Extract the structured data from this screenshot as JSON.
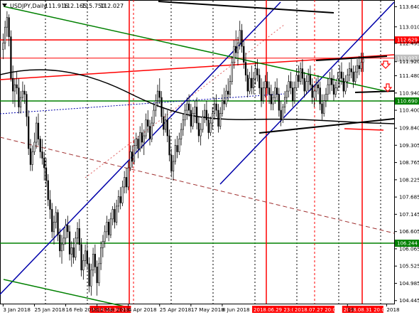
{
  "chart_data": {
    "type": "candlestick",
    "title": "USDJPY,Daily",
    "ohlc": {
      "open": "111.916",
      "high": "112.165",
      "low": "115.750",
      "close": "112.027"
    },
    "ylim": [
      104.35,
      113.85
    ],
    "y_ticks": [
      113.64,
      113.01,
      112.495,
      111.92,
      111.48,
      110.94,
      110.4,
      109.84,
      109.305,
      108.765,
      108.225,
      107.685,
      107.145,
      106.605,
      106.065,
      105.525,
      104.985,
      104.445
    ],
    "y_tick_labels": [
      "113.640",
      "113.010",
      "112.495",
      "111.920",
      "111.480",
      "110.940",
      "110.400",
      "109.840",
      "109.305",
      "108.765",
      "108.225",
      "107.685",
      "107.145",
      "106.605",
      "106.065",
      "105.525",
      "104.985",
      "104.445"
    ],
    "x_tick_labels": [
      "3 Jan 2018",
      "25 Jan 2018",
      "16 Feb 2018",
      "12 Mar 2018",
      "4 Apr 2018",
      "25 Apr 2018",
      "17 May 2018",
      "8 Jun 2018",
      "19",
      "2018"
    ],
    "x_tick_index": [
      0,
      16,
      32,
      48,
      64,
      80,
      96,
      112,
      176,
      196
    ],
    "n_bars": 200,
    "price_tags": [
      {
        "value": 112.6,
        "text": "112.629",
        "color": "#ff0000"
      },
      {
        "value": 112.03,
        "text": "112.027",
        "color": "#c0c0c0"
      },
      {
        "value": 110.69,
        "text": "110.690",
        "color": "#008000"
      },
      {
        "value": 106.24,
        "text": "106.244",
        "color": "#008000"
      }
    ],
    "date_tags": [
      {
        "index": 53,
        "text": "2018.03.30 23:00"
      },
      {
        "index": 136,
        "text": "2018.06.29 23:00"
      },
      {
        "index": 157,
        "text": "2018.07.27 20:00"
      },
      {
        "index": 182,
        "text": "2018.08.31 20:00"
      }
    ],
    "candles": [
      [
        112.3,
        112.8,
        112.0,
        112.5
      ],
      [
        112.5,
        113.2,
        112.3,
        113.0
      ],
      [
        113.0,
        113.5,
        112.7,
        113.3
      ],
      [
        113.3,
        113.4,
        112.4,
        112.7
      ],
      [
        112.7,
        112.9,
        111.3,
        111.4
      ],
      [
        111.4,
        111.8,
        110.6,
        111.0
      ],
      [
        111.0,
        111.4,
        110.5,
        111.2
      ],
      [
        111.2,
        111.6,
        110.9,
        111.1
      ],
      [
        111.1,
        111.4,
        110.3,
        110.5
      ],
      [
        110.5,
        111.0,
        110.3,
        110.8
      ],
      [
        110.8,
        111.3,
        110.7,
        111.0
      ],
      [
        111.0,
        111.2,
        110.6,
        110.9
      ],
      [
        110.9,
        111.0,
        109.9,
        110.2
      ],
      [
        110.2,
        110.4,
        109.0,
        109.2
      ],
      [
        109.2,
        109.5,
        108.5,
        108.7
      ],
      [
        108.7,
        109.3,
        108.5,
        109.1
      ],
      [
        109.1,
        109.7,
        109.0,
        109.4
      ],
      [
        109.4,
        110.2,
        109.2,
        110.0
      ],
      [
        110.0,
        110.3,
        109.3,
        109.5
      ],
      [
        109.5,
        109.6,
        108.9,
        109.1
      ],
      [
        109.1,
        109.5,
        108.7,
        108.9
      ],
      [
        108.9,
        109.1,
        108.2,
        108.6
      ],
      [
        108.6,
        108.9,
        108.0,
        108.2
      ],
      [
        108.2,
        108.4,
        107.4,
        107.6
      ],
      [
        107.6,
        107.9,
        107.0,
        107.3
      ],
      [
        107.3,
        107.5,
        106.4,
        106.6
      ],
      [
        106.6,
        107.1,
        106.2,
        106.9
      ],
      [
        106.9,
        107.4,
        106.7,
        107.2
      ],
      [
        107.2,
        107.3,
        106.3,
        106.5
      ],
      [
        106.5,
        106.7,
        105.8,
        106.0
      ],
      [
        106.0,
        106.5,
        105.6,
        106.2
      ],
      [
        106.2,
        106.7,
        106.0,
        106.4
      ],
      [
        106.4,
        107.0,
        106.2,
        106.8
      ],
      [
        106.8,
        107.1,
        106.4,
        106.6
      ],
      [
        106.6,
        106.8,
        105.7,
        105.9
      ],
      [
        105.9,
        106.3,
        105.5,
        106.1
      ],
      [
        106.1,
        106.4,
        105.6,
        105.8
      ],
      [
        105.8,
        106.6,
        105.7,
        106.4
      ],
      [
        106.4,
        106.9,
        106.2,
        106.7
      ],
      [
        106.7,
        107.0,
        106.0,
        106.2
      ],
      [
        106.2,
        106.4,
        105.2,
        105.4
      ],
      [
        105.4,
        105.9,
        105.1,
        105.7
      ],
      [
        105.7,
        106.2,
        105.5,
        106.0
      ],
      [
        106.0,
        106.3,
        105.4,
        105.6
      ],
      [
        105.6,
        105.8,
        104.7,
        104.9
      ],
      [
        104.9,
        105.6,
        104.6,
        105.4
      ],
      [
        105.4,
        106.1,
        105.2,
        105.9
      ],
      [
        105.9,
        106.2,
        105.3,
        105.5
      ],
      [
        105.5,
        105.7,
        104.6,
        105.0
      ],
      [
        105.0,
        105.8,
        104.9,
        105.6
      ],
      [
        105.6,
        106.3,
        105.4,
        106.1
      ],
      [
        106.1,
        106.5,
        105.8,
        106.3
      ],
      [
        106.3,
        106.8,
        106.1,
        106.6
      ],
      [
        106.6,
        107.1,
        106.4,
        106.9
      ],
      [
        106.9,
        107.0,
        106.3,
        106.5
      ],
      [
        106.5,
        107.2,
        106.4,
        107.0
      ],
      [
        107.0,
        107.4,
        106.8,
        107.3
      ],
      [
        107.3,
        107.5,
        106.7,
        106.9
      ],
      [
        106.9,
        107.6,
        106.8,
        107.4
      ],
      [
        107.4,
        107.9,
        107.2,
        107.7
      ],
      [
        107.7,
        108.0,
        107.3,
        107.5
      ],
      [
        107.5,
        108.2,
        107.4,
        108.0
      ],
      [
        108.0,
        108.5,
        107.8,
        108.3
      ],
      [
        108.3,
        108.6,
        107.8,
        108.0
      ],
      [
        108.0,
        108.8,
        107.9,
        108.6
      ],
      [
        108.6,
        109.3,
        108.5,
        109.1
      ],
      [
        109.1,
        109.3,
        108.6,
        108.8
      ],
      [
        108.8,
        109.5,
        108.7,
        109.3
      ],
      [
        109.3,
        109.7,
        109.1,
        109.5
      ],
      [
        109.5,
        109.6,
        108.9,
        109.2
      ],
      [
        109.2,
        109.9,
        109.1,
        109.7
      ],
      [
        109.7,
        110.0,
        109.2,
        109.4
      ],
      [
        109.4,
        109.8,
        109.0,
        109.6
      ],
      [
        109.6,
        110.3,
        109.5,
        110.1
      ],
      [
        110.1,
        110.4,
        109.7,
        109.9
      ],
      [
        109.9,
        110.1,
        109.3,
        109.5
      ],
      [
        109.5,
        110.2,
        109.4,
        110.0
      ],
      [
        110.0,
        110.6,
        109.9,
        110.4
      ],
      [
        110.4,
        110.9,
        110.2,
        110.7
      ],
      [
        110.7,
        111.2,
        110.5,
        111.0
      ],
      [
        111.0,
        111.4,
        110.6,
        110.8
      ],
      [
        110.8,
        111.0,
        110.0,
        110.2
      ],
      [
        110.2,
        110.5,
        109.6,
        109.8
      ],
      [
        109.8,
        110.3,
        109.7,
        110.1
      ],
      [
        110.1,
        110.4,
        109.4,
        109.6
      ],
      [
        109.6,
        109.8,
        108.8,
        109.0
      ],
      [
        109.0,
        109.2,
        108.3,
        108.5
      ],
      [
        108.5,
        109.0,
        108.2,
        108.8
      ],
      [
        108.8,
        109.5,
        108.7,
        109.3
      ],
      [
        109.3,
        109.6,
        108.9,
        109.1
      ],
      [
        109.1,
        109.7,
        109.0,
        109.5
      ],
      [
        109.5,
        110.0,
        109.3,
        109.8
      ],
      [
        109.8,
        110.3,
        109.6,
        110.1
      ],
      [
        110.1,
        110.6,
        109.9,
        110.4
      ],
      [
        110.4,
        110.8,
        110.1,
        110.6
      ],
      [
        110.6,
        110.9,
        110.2,
        110.4
      ],
      [
        110.4,
        110.6,
        109.7,
        109.9
      ],
      [
        109.9,
        110.5,
        109.8,
        110.3
      ],
      [
        110.3,
        110.7,
        110.0,
        110.5
      ],
      [
        110.5,
        110.8,
        109.8,
        110.0
      ],
      [
        110.0,
        110.2,
        109.4,
        109.6
      ],
      [
        109.6,
        110.0,
        109.3,
        109.8
      ],
      [
        109.8,
        110.4,
        109.7,
        110.2
      ],
      [
        110.2,
        110.6,
        110.0,
        110.4
      ],
      [
        110.4,
        110.7,
        109.9,
        110.1
      ],
      [
        110.1,
        110.3,
        109.5,
        109.7
      ],
      [
        109.7,
        110.2,
        109.6,
        110.0
      ],
      [
        110.0,
        110.5,
        109.8,
        110.3
      ],
      [
        110.3,
        110.8,
        110.1,
        110.6
      ],
      [
        110.6,
        110.9,
        110.2,
        110.4
      ],
      [
        110.4,
        110.6,
        109.7,
        109.9
      ],
      [
        109.9,
        110.5,
        109.8,
        110.3
      ],
      [
        110.3,
        110.9,
        110.2,
        110.7
      ],
      [
        110.7,
        111.1,
        110.4,
        110.6
      ],
      [
        110.6,
        111.2,
        110.5,
        111.0
      ],
      [
        111.0,
        111.4,
        110.7,
        110.9
      ],
      [
        110.9,
        111.5,
        110.8,
        111.3
      ],
      [
        111.3,
        112.1,
        111.2,
        111.9
      ],
      [
        111.9,
        112.6,
        111.7,
        112.4
      ],
      [
        112.4,
        112.9,
        112.0,
        112.2
      ],
      [
        112.2,
        112.7,
        111.8,
        112.5
      ],
      [
        112.5,
        113.2,
        112.3,
        112.9
      ],
      [
        112.9,
        113.1,
        112.2,
        112.4
      ],
      [
        112.4,
        112.6,
        111.7,
        111.9
      ],
      [
        111.9,
        112.2,
        111.3,
        111.5
      ],
      [
        111.5,
        111.7,
        110.8,
        111.0
      ],
      [
        111.0,
        111.6,
        110.9,
        111.4
      ],
      [
        111.4,
        111.8,
        110.9,
        111.1
      ],
      [
        111.1,
        111.6,
        110.9,
        111.4
      ],
      [
        111.4,
        111.9,
        111.2,
        111.7
      ],
      [
        111.7,
        112.0,
        111.3,
        111.5
      ],
      [
        111.5,
        111.7,
        110.9,
        111.1
      ],
      [
        111.1,
        111.4,
        110.5,
        110.7
      ],
      [
        110.7,
        111.3,
        110.6,
        111.1
      ],
      [
        111.1,
        111.5,
        110.8,
        111.3
      ],
      [
        111.3,
        111.6,
        110.9,
        111.1
      ],
      [
        111.1,
        111.3,
        110.6,
        110.9
      ],
      [
        110.9,
        111.2,
        110.4,
        110.6
      ],
      [
        110.6,
        111.0,
        110.4,
        110.8
      ],
      [
        110.8,
        111.3,
        110.6,
        111.1
      ],
      [
        111.1,
        111.4,
        110.7,
        110.9
      ],
      [
        110.9,
        111.1,
        110.2,
        110.4
      ],
      [
        110.4,
        110.7,
        109.9,
        110.1
      ],
      [
        110.1,
        110.6,
        110.0,
        110.5
      ],
      [
        110.5,
        111.0,
        110.3,
        110.8
      ],
      [
        110.8,
        111.2,
        110.6,
        111.0
      ],
      [
        111.0,
        111.5,
        110.8,
        111.3
      ],
      [
        111.3,
        111.6,
        110.9,
        111.1
      ],
      [
        111.1,
        111.3,
        110.5,
        110.7
      ],
      [
        110.7,
        111.3,
        110.6,
        111.1
      ],
      [
        111.1,
        111.7,
        111.0,
        111.5
      ],
      [
        111.5,
        111.8,
        111.1,
        111.3
      ],
      [
        111.3,
        111.9,
        111.2,
        111.7
      ],
      [
        111.7,
        112.0,
        111.2,
        111.4
      ],
      [
        111.4,
        111.6,
        110.8,
        111.0
      ],
      [
        111.0,
        111.5,
        110.9,
        111.3
      ],
      [
        111.3,
        111.7,
        111.0,
        111.5
      ],
      [
        111.5,
        111.8,
        111.0,
        111.2
      ],
      [
        111.2,
        111.4,
        110.6,
        110.8
      ],
      [
        110.8,
        111.2,
        110.5,
        111.0
      ],
      [
        111.0,
        111.4,
        110.7,
        111.2
      ],
      [
        111.2,
        111.5,
        110.9,
        111.1
      ],
      [
        111.1,
        111.3,
        110.4,
        110.6
      ],
      [
        110.6,
        110.9,
        110.1,
        110.3
      ],
      [
        110.3,
        110.9,
        110.2,
        110.7
      ],
      [
        110.7,
        111.1,
        110.5,
        110.9
      ],
      [
        110.9,
        111.4,
        110.7,
        111.2
      ],
      [
        111.2,
        111.6,
        110.9,
        111.4
      ],
      [
        111.4,
        111.7,
        111.0,
        111.2
      ],
      [
        111.2,
        111.5,
        110.7,
        110.9
      ],
      [
        110.9,
        111.3,
        110.8,
        111.1
      ],
      [
        111.1,
        111.6,
        111.0,
        111.4
      ],
      [
        111.4,
        111.8,
        111.1,
        111.6
      ],
      [
        111.6,
        111.9,
        111.2,
        111.4
      ],
      [
        111.4,
        111.6,
        110.8,
        111.0
      ],
      [
        111.0,
        111.5,
        110.9,
        111.3
      ],
      [
        111.3,
        111.7,
        111.1,
        111.5
      ],
      [
        111.5,
        111.9,
        111.3,
        111.7
      ],
      [
        111.7,
        112.0,
        111.4,
        111.6
      ],
      [
        111.6,
        111.8,
        111.1,
        111.3
      ],
      [
        111.3,
        111.8,
        111.2,
        111.6
      ],
      [
        111.6,
        112.0,
        111.4,
        111.8
      ],
      [
        111.8,
        112.1,
        111.5,
        111.7
      ],
      [
        111.7,
        112.2,
        111.6,
        111.9
      ],
      [
        111.9,
        112.2,
        111.6,
        112.0
      ]
    ]
  }
}
